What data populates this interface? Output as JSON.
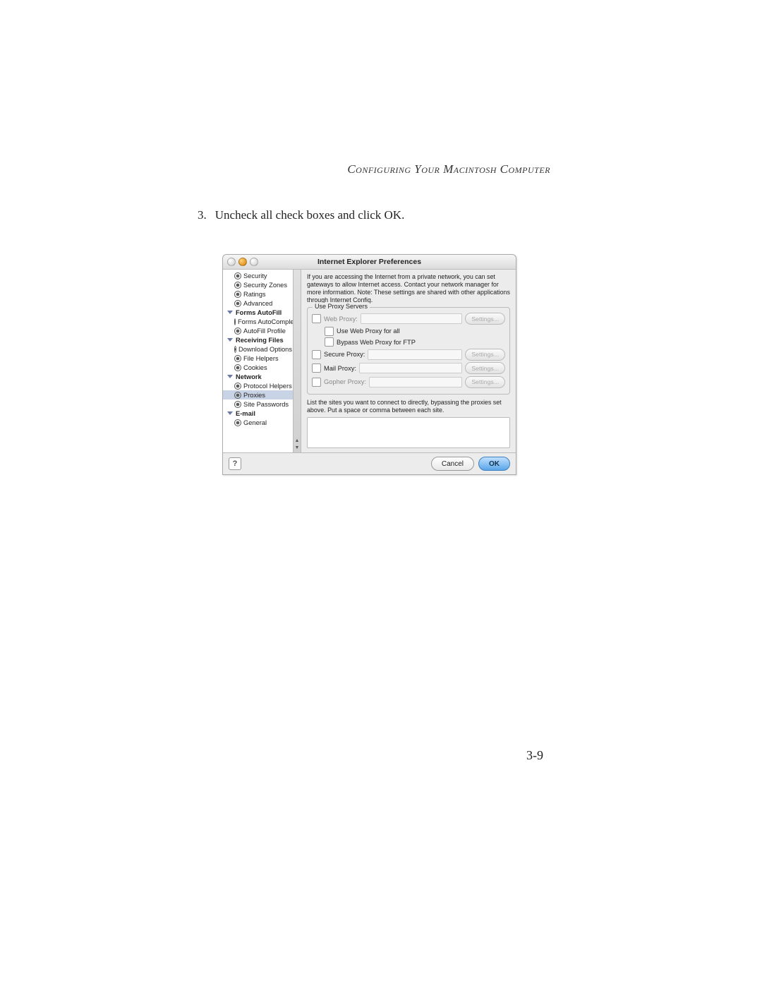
{
  "header": "Configuring Your Macintosh Computer",
  "step_number": "3.",
  "step_text": "Uncheck all check boxes and click OK.",
  "page_number": "3-9",
  "window": {
    "title": "Internet Explorer Preferences",
    "sidebar": [
      {
        "type": "child",
        "label": "Security"
      },
      {
        "type": "child",
        "label": "Security Zones"
      },
      {
        "type": "child",
        "label": "Ratings"
      },
      {
        "type": "child",
        "label": "Advanced"
      },
      {
        "type": "header",
        "label": "Forms AutoFill"
      },
      {
        "type": "child",
        "label": "Forms AutoComplete"
      },
      {
        "type": "child",
        "label": "AutoFill Profile"
      },
      {
        "type": "header",
        "label": "Receiving Files"
      },
      {
        "type": "child",
        "label": "Download Options"
      },
      {
        "type": "child",
        "label": "File Helpers"
      },
      {
        "type": "child",
        "label": "Cookies"
      },
      {
        "type": "header",
        "label": "Network"
      },
      {
        "type": "child",
        "label": "Protocol Helpers"
      },
      {
        "type": "child",
        "label": "Proxies",
        "selected": true
      },
      {
        "type": "child",
        "label": "Site Passwords"
      },
      {
        "type": "header",
        "label": "E-mail"
      },
      {
        "type": "child",
        "label": "General"
      }
    ],
    "intro": "If you are accessing the Internet from a private network, you can set gateways to allow Internet access.  Contact your network manager for more information.  Note: These settings are shared with other applications through Internet Config.",
    "group_legend": "Use Proxy Servers",
    "proxies": {
      "web": {
        "label": "Web Proxy:",
        "settings": "Settings..."
      },
      "useall": {
        "label": "Use Web Proxy for all"
      },
      "bypassftp": {
        "label": "Bypass Web Proxy for FTP"
      },
      "secure": {
        "label": "Secure Proxy:",
        "settings": "Settings..."
      },
      "mail": {
        "label": "Mail Proxy:",
        "settings": "Settings..."
      },
      "gopher": {
        "label": "Gopher Proxy:",
        "settings": "Settings..."
      }
    },
    "bypass_text": "List the sites you want to connect to directly,  bypassing the proxies set above.  Put a space or comma between each site.",
    "buttons": {
      "help": "?",
      "cancel": "Cancel",
      "ok": "OK"
    }
  }
}
